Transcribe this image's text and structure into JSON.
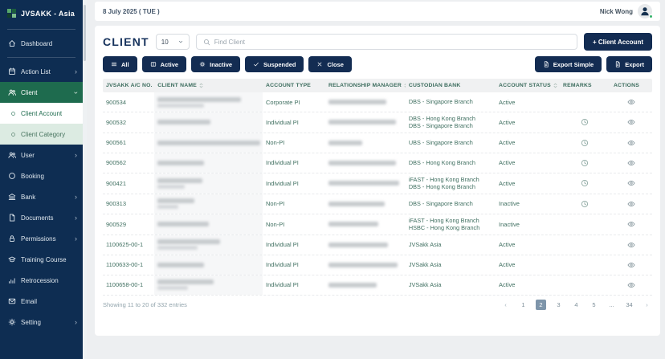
{
  "colors": {
    "sidebar_bg": "#0e2d52",
    "accent_green": "#1e6b4e",
    "submenu_light_green": "#dcebe2",
    "button_navy": "#132c52",
    "table_text_green": "#3f6f60",
    "active_page_bg": "#7e95aa",
    "status_dot_green": "#35b36b"
  },
  "sidebar": {
    "logo_text": "JVSAKK - Asia",
    "items": [
      {
        "name": "sidebar-item-dashboard",
        "label": "Dashboard",
        "icon": "home-icon",
        "chevron": ""
      },
      {
        "divider": true
      },
      {
        "name": "sidebar-item-action-list",
        "label": "Action List",
        "icon": "calendar-icon",
        "chevron": "right"
      },
      {
        "name": "sidebar-item-client",
        "label": "Client",
        "icon": "users-icon",
        "state": "expanded",
        "chevron": "down"
      },
      {
        "name": "sidebar-item-client-account",
        "label": "Client Account",
        "icon": "dot-icon",
        "state": "sub-active",
        "chevron": ""
      },
      {
        "name": "sidebar-item-client-category",
        "label": "Client Category",
        "icon": "dot-icon",
        "state": "sub",
        "chevron": ""
      },
      {
        "name": "sidebar-item-user",
        "label": "User",
        "icon": "user-icon",
        "chevron": "right"
      },
      {
        "name": "sidebar-item-booking",
        "label": "Booking",
        "icon": "circle-icon",
        "chevron": ""
      },
      {
        "name": "sidebar-item-bank",
        "label": "Bank",
        "icon": "bank-icon",
        "chevron": "right"
      },
      {
        "name": "sidebar-item-documents",
        "label": "Documents",
        "icon": "document-icon",
        "chevron": "right"
      },
      {
        "name": "sidebar-item-permissions",
        "label": "Permissions",
        "icon": "lock-icon",
        "chevron": "right"
      },
      {
        "name": "sidebar-item-training-course",
        "label": "Training Course",
        "icon": "training-icon",
        "chevron": ""
      },
      {
        "name": "sidebar-item-retrocession",
        "label": "Retrocession",
        "icon": "chart-icon",
        "chevron": ""
      },
      {
        "name": "sidebar-item-email",
        "label": "Email",
        "icon": "mail-icon",
        "chevron": ""
      },
      {
        "name": "sidebar-item-setting",
        "label": "Setting",
        "icon": "gear-icon",
        "chevron": "right"
      }
    ]
  },
  "header": {
    "date": "8 July 2025 ( TUE )",
    "user": "Nick Wong"
  },
  "toolbar": {
    "title": "CLIENT",
    "page_size": "10",
    "search_placeholder": "Find Client",
    "add_button": "+ Client Account",
    "filters": [
      {
        "name": "filter-all-button",
        "label": "All",
        "icon": "menu-icon"
      },
      {
        "name": "filter-active-button",
        "label": "Active",
        "icon": "card-icon"
      },
      {
        "name": "filter-inactive-button",
        "label": "Inactive",
        "icon": "sun-icon"
      },
      {
        "name": "filter-suspended-button",
        "label": "Suspended",
        "icon": "check-icon"
      },
      {
        "name": "filter-close-button",
        "label": "Close",
        "icon": "x-icon"
      }
    ],
    "exports": [
      {
        "name": "export-simple-button",
        "label": "Export Simple",
        "icon": "file-icon"
      },
      {
        "name": "export-button",
        "label": "Export",
        "icon": "file-icon"
      }
    ]
  },
  "table": {
    "columns": [
      {
        "label": "JVSAKK A/C NO.",
        "sortable": true
      },
      {
        "label": "CLIENT NAME",
        "sortable": true
      },
      {
        "label": "ACCOUNT TYPE",
        "sortable": false
      },
      {
        "label": "RELATIONSHIP MANAGER",
        "sortable": true
      },
      {
        "label": "CUSTODIAN BANK",
        "sortable": false
      },
      {
        "label": "ACCOUNT STATUS",
        "sortable": true
      },
      {
        "label": "REMARKS",
        "sortable": false,
        "center": true
      },
      {
        "label": "ACTIONS",
        "sortable": false,
        "center": true
      }
    ],
    "rows": [
      {
        "acct": "900534",
        "type": "Corporate PI",
        "banks": [
          "DBS - Singapore Branch"
        ],
        "status": "Active",
        "remark": false,
        "name_lines": [
          104,
          58
        ],
        "rm_lines": [
          72
        ]
      },
      {
        "acct": "900532",
        "type": "Individual PI",
        "banks": [
          "DBS - Hong Kong Branch",
          "DBS - Singapore Branch"
        ],
        "status": "Active",
        "remark": true,
        "name_lines": [
          66
        ],
        "rm_lines": [
          84
        ]
      },
      {
        "acct": "900561",
        "type": "Non-PI",
        "banks": [
          "UBS - Singapore Branch"
        ],
        "status": "Active",
        "remark": true,
        "name_lines": [
          128
        ],
        "rm_lines": [
          42
        ]
      },
      {
        "acct": "900562",
        "type": "Individual PI",
        "banks": [
          "DBS - Hong Kong Branch"
        ],
        "status": "Active",
        "remark": true,
        "name_lines": [
          58
        ],
        "rm_lines": [
          84
        ]
      },
      {
        "acct": "900421",
        "type": "Individual PI",
        "banks": [
          "iFAST - Hong Kong Branch",
          "DBS - Hong Kong Branch"
        ],
        "status": "Active",
        "remark": true,
        "name_lines": [
          56,
          34
        ],
        "rm_lines": [
          88
        ]
      },
      {
        "acct": "900313",
        "type": "Non-PI",
        "banks": [
          "DBS - Singapore Branch"
        ],
        "status": "Inactive",
        "remark": true,
        "name_lines": [
          46,
          26
        ],
        "rm_lines": [
          70
        ]
      },
      {
        "acct": "900529",
        "type": "Non-PI",
        "banks": [
          "iFAST - Hong Kong Branch",
          "HSBC - Hong Kong Branch"
        ],
        "status": "Inactive",
        "remark": false,
        "name_lines": [
          64
        ],
        "rm_lines": [
          62
        ]
      },
      {
        "acct": "1100625-00-1",
        "type": "Individual PI",
        "banks": [
          "JVSakk Asia"
        ],
        "status": "Active",
        "remark": false,
        "name_lines": [
          78,
          50
        ],
        "rm_lines": [
          74
        ]
      },
      {
        "acct": "1100633-00-1",
        "type": "Individual PI",
        "banks": [
          "JVSakk Asia"
        ],
        "status": "Active",
        "remark": false,
        "name_lines": [
          58
        ],
        "rm_lines": [
          86
        ]
      },
      {
        "acct": "1100658-00-1",
        "type": "Individual PI",
        "banks": [
          "JVSakk Asia"
        ],
        "status": "Active",
        "remark": false,
        "name_lines": [
          70,
          38
        ],
        "rm_lines": [
          60
        ]
      }
    ]
  },
  "footer": {
    "showing": "Showing 11 to 20 of 332 entries",
    "active_page": "2",
    "pages": [
      {
        "label": "‹",
        "cls": "nav"
      },
      {
        "label": "1"
      },
      {
        "label": "2",
        "cls": "active"
      },
      {
        "label": "3"
      },
      {
        "label": "4"
      },
      {
        "label": "5"
      },
      {
        "label": "...",
        "cls": "dots"
      },
      {
        "label": "34"
      },
      {
        "label": "›",
        "cls": "nav"
      }
    ]
  }
}
